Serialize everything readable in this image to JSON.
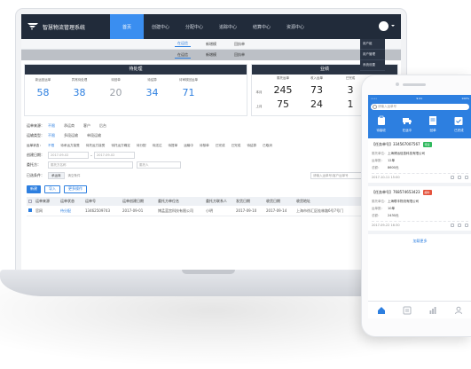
{
  "app": {
    "title": "智慧物流管理系统"
  },
  "nav": {
    "items": [
      "首页",
      "创建中心",
      "分配中心",
      "追踪中心",
      "结算中心",
      "资源中心"
    ]
  },
  "dropdown": {
    "items": [
      "用户组",
      "用户管理",
      "系统设置"
    ]
  },
  "subtabs_1": [
    "在运信",
    "新增模",
    "回执单"
  ],
  "subtabs_2": [
    "在运信",
    "新增模",
    "回执单"
  ],
  "pending": {
    "title": "待处理",
    "items": [
      {
        "label": "新运回运单",
        "value": "58"
      },
      {
        "label": "异常待处理",
        "value": "38"
      },
      {
        "label": "待回单",
        "value": "20"
      },
      {
        "label": "待结算",
        "value": "34"
      },
      {
        "label": "待审核回运单",
        "value": "71"
      }
    ]
  },
  "performance": {
    "title": "业绩",
    "columns": [
      "委托运单",
      "收入运单",
      "已完成"
    ],
    "rows": [
      {
        "label": "本月",
        "values": [
          "245",
          "73",
          "3"
        ]
      },
      {
        "label": "上月",
        "values": [
          "75",
          "24",
          "1"
        ]
      }
    ]
  },
  "filters": {
    "source": {
      "label": "运单来源：",
      "options": [
        "不限",
        "承运商",
        "客户",
        "后台"
      ]
    },
    "type": {
      "label": "运输类型：",
      "options": [
        "不限",
        "多段运输",
        "单段运输"
      ]
    },
    "status": {
      "label": "运单状态：",
      "options": [
        "不限",
        "待承运方接受",
        "待托运方接受",
        "待托运方确定",
        "待分配",
        "待送达",
        "待提单",
        "运输中",
        "待核单",
        "已完成",
        "已完成",
        "待结算",
        "已取消"
      ]
    },
    "create_date": {
      "label": "创建日期：",
      "start": "2017-09-02",
      "end": "2017-09-02"
    },
    "shipper": {
      "label": "委托方：",
      "placeholder": "委托方名称",
      "placeholder2": "委托人"
    },
    "selected": {
      "label": "已选条件：",
      "tag": "承运商",
      "clear": "清空条件"
    },
    "search_placeholder": "请输入运单号/客户运单号"
  },
  "actions": {
    "new": "新建",
    "import": "导入",
    "more": "更多操作"
  },
  "table": {
    "headers": [
      "运单来源",
      "运单状态",
      "运单号",
      "运单创建日期",
      "委托方单位名",
      "委托方联系人",
      "发货日期",
      "收货日期",
      "收货地址"
    ],
    "rows": [
      [
        "官网",
        "待分配",
        "13462509743",
        "2017-09-01",
        "博孟蓝宫科技有限公司",
        "小明",
        "2017-09-10",
        "2017-09-14",
        "上海市徐汇区桂林路6号7号门"
      ]
    ]
  },
  "phone": {
    "status": {
      "carrier": "••••",
      "time": "9:41",
      "battery": "100%"
    },
    "search_placeholder": "请输入运单号",
    "quick": [
      "待接收",
      "在途中",
      "回单",
      "已完成"
    ],
    "cards": [
      {
        "no": "【任务单号】334567007567",
        "badge": "待运",
        "badge_color": "green",
        "fields": [
          [
            "委托单位：",
            "上海博远信息科技有限公司"
          ],
          [
            "运单数：",
            "12单"
          ],
          [
            "总额：",
            "8600元"
          ]
        ],
        "footer": "2017-10-11 15:00"
      },
      {
        "no": "【任务单号】768574653423",
        "badge": "超时",
        "badge_color": "red",
        "fields": [
          [
            "委托单位：",
            "上海联丰物流有限公司"
          ],
          [
            "运单数：",
            "10单"
          ],
          [
            "总额：",
            "2430元"
          ]
        ],
        "footer": "2017-09-22 16:30"
      }
    ],
    "load_more": "加载更多"
  }
}
